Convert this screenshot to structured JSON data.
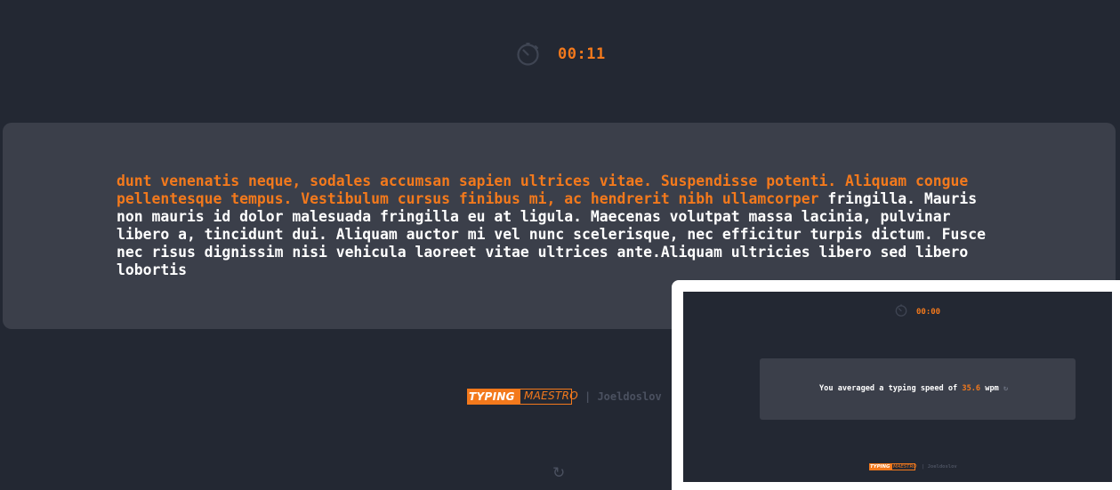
{
  "timer": {
    "icon": "stopwatch-icon",
    "value": "00:11"
  },
  "passage": {
    "typed": "dunt venenatis neque, sodales accumsan sapien ultrices vitae. Suspendisse potenti. Aliquam congue pellentesque tempus. Vestibulum cursus finibus mi, ac hendrerit nibh ullamcorper",
    "remaining": " fringilla. Mauris non mauris id dolor malesuada fringilla eu at ligula. Maecenas volutpat massa lacinia, pulvinar libero a, tincidunt dui. Aliquam auctor mi vel nunc scelerisque, nec efficitur turpis dictum. Fusce nec risus dignissim nisi vehicula laoreet vitae ultrices ante.Aliquam ultricies libero sed libero lobortis"
  },
  "footer": {
    "logo_typing": "TYPING",
    "logo_maestro": "MAESTRO",
    "author": "| Joeldoslov",
    "reload_icon": "reload-icon"
  },
  "preview": {
    "timer_value": "00:00",
    "result_prefix": "You averaged a typing speed of ",
    "result_value": "35.6",
    "result_suffix": " wpm",
    "logo_typing": "TYPING",
    "logo_maestro": "MAESTRO",
    "author": "| Joeldoslov"
  },
  "colors": {
    "background": "#232833",
    "panel": "#3b3f4a",
    "accent": "#f3791c",
    "text": "#ffffff",
    "muted": "#4b5160"
  }
}
